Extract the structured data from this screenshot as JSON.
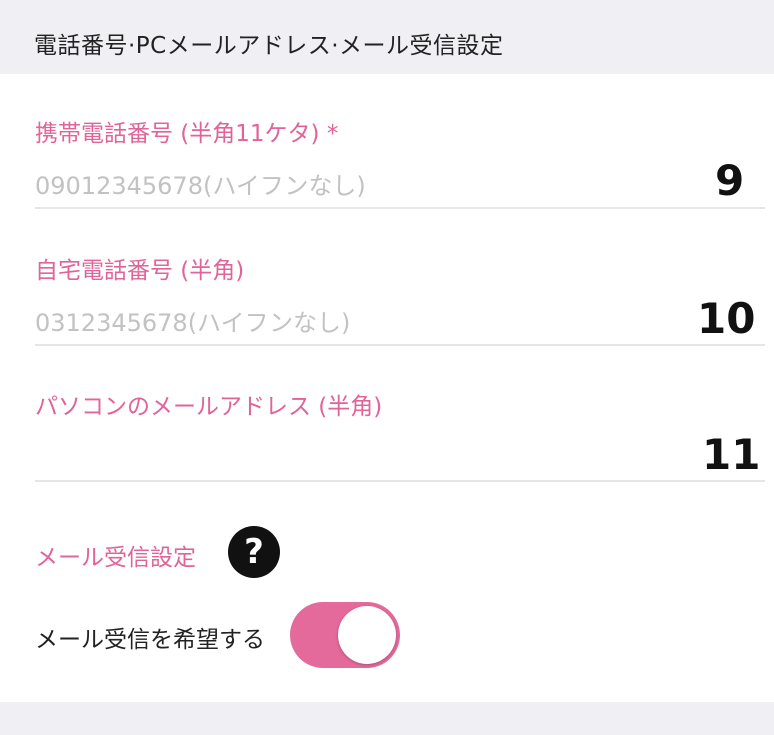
{
  "section": {
    "title": "電話番号·PCメールアドレス·メール受信設定"
  },
  "fields": [
    {
      "label": "携帯電話番号 (半角11ケタ) *",
      "placeholder": "09012345678(ハイフンなし)",
      "value": "",
      "number": "9"
    },
    {
      "label": "自宅電話番号 (半角)",
      "placeholder": "0312345678(ハイフンなし)",
      "value": "",
      "number": "10"
    },
    {
      "label": "パソコンのメールアドレス (半角)",
      "placeholder": "",
      "value": "",
      "number": "11"
    }
  ],
  "mail": {
    "label": "メール受信設定",
    "help_icon": "?",
    "toggle_label": "メール受信を希望する",
    "toggle_on": true
  },
  "colors": {
    "accent": "#e0649a",
    "toggle": "#e56a9c",
    "header_bg": "#efeff4"
  }
}
